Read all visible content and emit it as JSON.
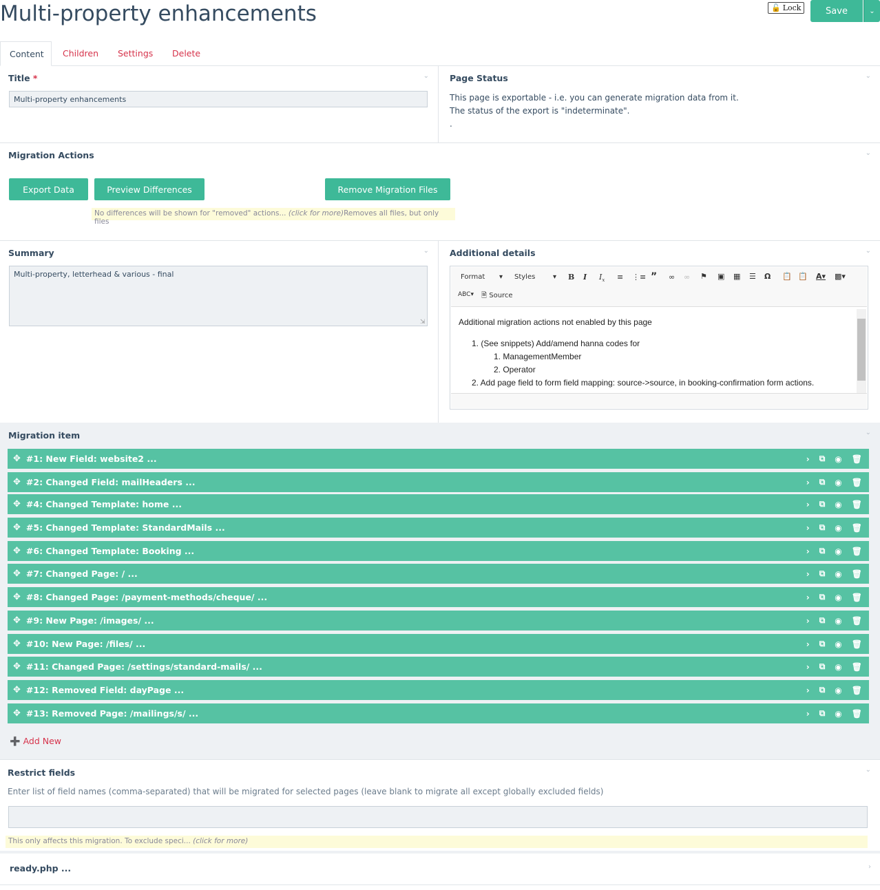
{
  "page": {
    "title": "Multi-property enhancements"
  },
  "header": {
    "lock_label": "Lock",
    "save_label": "Save"
  },
  "tabs": [
    {
      "label": "Content",
      "active": true
    },
    {
      "label": "Children"
    },
    {
      "label": "Settings"
    },
    {
      "label": "Delete"
    }
  ],
  "title_field": {
    "label": "Title",
    "required_mark": "*",
    "value": "Multi-property enhancements"
  },
  "page_status": {
    "label": "Page Status",
    "line1": "This page is exportable - i.e. you can generate migration data from it.",
    "line2": "The status of the export is \"indeterminate\".",
    "line3": "."
  },
  "migration_actions": {
    "label": "Migration Actions",
    "export_label": "Export Data",
    "preview_label": "Preview Differences",
    "remove_label": "Remove Migration Files",
    "note_preview": "No differences will be shown for \"removed\" actions...",
    "note_click": "(click for more)",
    "note_remove": "Removes all files, but only files"
  },
  "summary": {
    "label": "Summary",
    "value": "Multi-property, letterhead & various - final"
  },
  "additional_details": {
    "label": "Additional details",
    "toolbar": {
      "format": "Format",
      "styles": "Styles",
      "source": "Source"
    },
    "content": {
      "intro": "Additional migration actions not enabled by this page",
      "item1": "1. (See snippets) Add/amend hanna codes for",
      "item1a": "1. ManagementMember",
      "item1b": "2. Operator",
      "item2": "2. Add page field to form field mapping: source->source, in booking-confirmation form actions."
    }
  },
  "migration_item": {
    "label": "Migration item",
    "items": [
      "#1: New Field: website2 ...",
      "#2: Changed Field: mailHeaders ...",
      "#4: Changed Template: home ...",
      "#5: Changed Template: StandardMails ...",
      "#6: Changed Template: Booking ...",
      "#7: Changed Page: / ...",
      "#8: Changed Page: /payment-methods/cheque/ ...",
      "#9: New Page: /images/ ...",
      "#10: New Page: /files/ ...",
      "#11: Changed Page: /settings/standard-mails/ ...",
      "#12: Removed Field: dayPage ...",
      "#13: Removed Page: /mailings/s/ ..."
    ],
    "add_new_label": "Add New"
  },
  "restrict_fields": {
    "label": "Restrict fields",
    "description": "Enter list of field names (comma-separated) that will be migrated for selected pages (leave blank to migrate all except globally excluded fields)",
    "value": "",
    "note": "This only affects this migration. To exclude speci...",
    "note_click": "(click for more)"
  },
  "ready": {
    "label": "ready.php ..."
  },
  "colors": {
    "accent": "#3eb998",
    "row": "#56c2a3",
    "link": "#d6334b",
    "text": "#354b60"
  }
}
